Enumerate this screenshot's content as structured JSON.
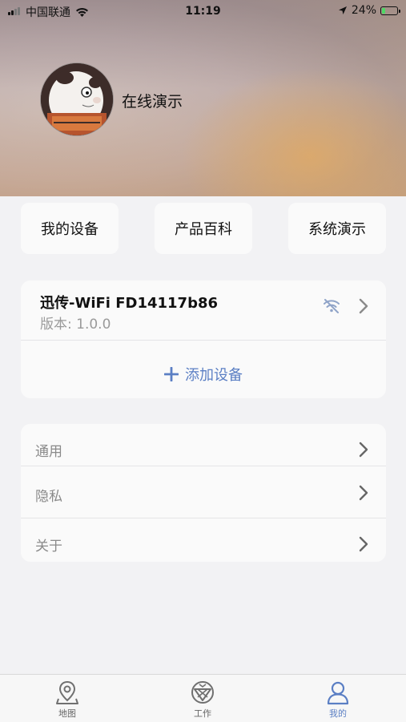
{
  "status_bar": {
    "carrier": "中国联通",
    "time": "11:19",
    "battery_percent": "24%",
    "battery_level": 0.24,
    "icons": [
      "signal-icon",
      "wifi-icon",
      "location-arrow-icon",
      "battery-icon"
    ]
  },
  "profile": {
    "username": "在线演示"
  },
  "quick_actions": {
    "my_devices": "我的设备",
    "product_wiki": "产品百科",
    "system_demo": "系统演示"
  },
  "device": {
    "name": "迅传-WiFi FD14117b86",
    "version": "版本: 1.0.0",
    "add_label": "添加设备"
  },
  "settings": {
    "items": [
      "通用",
      "隐私",
      "关于"
    ]
  },
  "tabbar": {
    "items": [
      {
        "label": "地图",
        "icon": "map-pin-icon"
      },
      {
        "label": "工作",
        "icon": "work-icon"
      },
      {
        "label": "我的",
        "icon": "profile-icon"
      }
    ],
    "active_index": 2
  },
  "colors": {
    "accent": "#5b7fc4",
    "charging": "#4cd964"
  }
}
